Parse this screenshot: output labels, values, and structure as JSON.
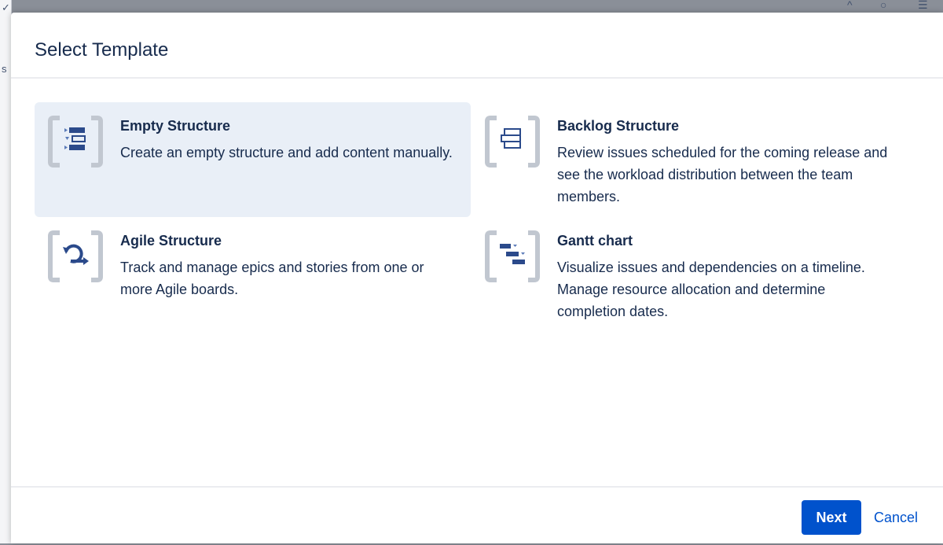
{
  "dialog": {
    "title": "Select Template"
  },
  "templates": [
    {
      "name": "Empty Structure",
      "description": "Create an empty structure and add content manually.",
      "icon": "empty-structure-icon",
      "selected": true
    },
    {
      "name": "Backlog Structure",
      "description": "Review issues scheduled for the coming release and see the workload distribution between the team members.",
      "icon": "backlog-structure-icon",
      "selected": false
    },
    {
      "name": "Agile Structure",
      "description": "Track and manage epics and stories from one or more Agile boards.",
      "icon": "agile-structure-icon",
      "selected": false
    },
    {
      "name": "Gantt chart",
      "description": "Visualize issues and dependencies on a timeline. Manage resource allocation and determine completion dates.",
      "icon": "gantt-chart-icon",
      "selected": false
    }
  ],
  "footer": {
    "next_label": "Next",
    "cancel_label": "Cancel"
  },
  "colors": {
    "primary": "#0052cc",
    "selected_card_bg": "#e9eff7",
    "text": "#172b4d",
    "icon_bracket": "#c1c7d0",
    "icon_bar": "#2b4a8b"
  }
}
